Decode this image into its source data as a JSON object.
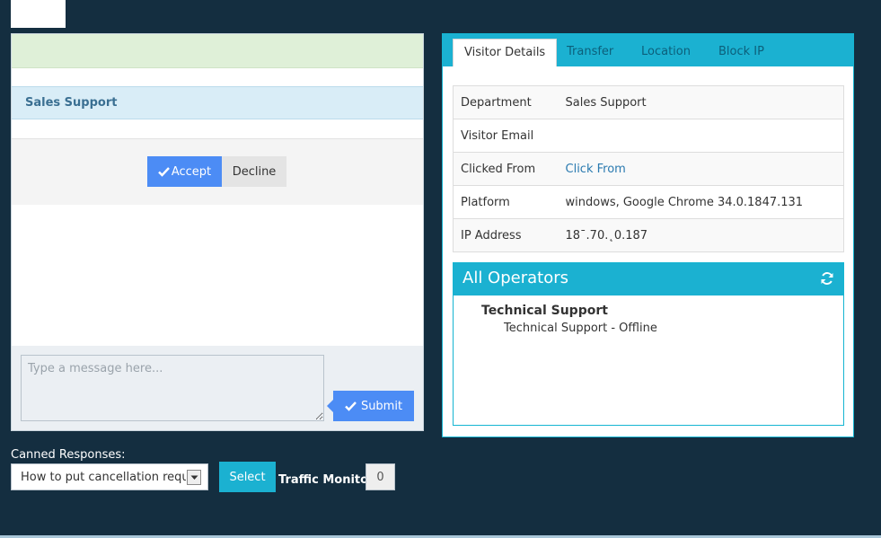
{
  "chat": {
    "department": "Sales Support",
    "accept_label": "Accept",
    "decline_label": "Decline",
    "message_placeholder": "Type a message here...",
    "message_value": "",
    "submit_label": "Submit"
  },
  "tabs": [
    {
      "label": "Visitor Details",
      "active": true
    },
    {
      "label": "Transfer",
      "active": false
    },
    {
      "label": "Location",
      "active": false
    },
    {
      "label": "Block IP",
      "active": false
    }
  ],
  "visitor": {
    "rows": [
      {
        "key": "Department",
        "value": "Sales Support"
      },
      {
        "key": "Visitor Email",
        "value": ""
      },
      {
        "key": "Clicked From",
        "value": "Click From"
      },
      {
        "key": "Platform",
        "value": "windows, Google Chrome 34.0.1847.131"
      },
      {
        "key": "IP Address",
        "value": "18ˉ.70.˛0.187"
      }
    ]
  },
  "operators": {
    "title": "All Operators",
    "group": "Technical Support",
    "item": "Technical Support - Offline"
  },
  "bottom": {
    "canned_label": "Canned Responses:",
    "canned_selected": "How to put cancellation request",
    "select_label": "Select",
    "traffic_label": "Traffic Monitor:",
    "traffic_value": "0"
  },
  "colors": {
    "background": "#142e40",
    "accent": "#1bb1d1",
    "primary_button": "#4c8cf5",
    "success_bar": "#dff0d8",
    "info_bar": "#d9edf7"
  }
}
